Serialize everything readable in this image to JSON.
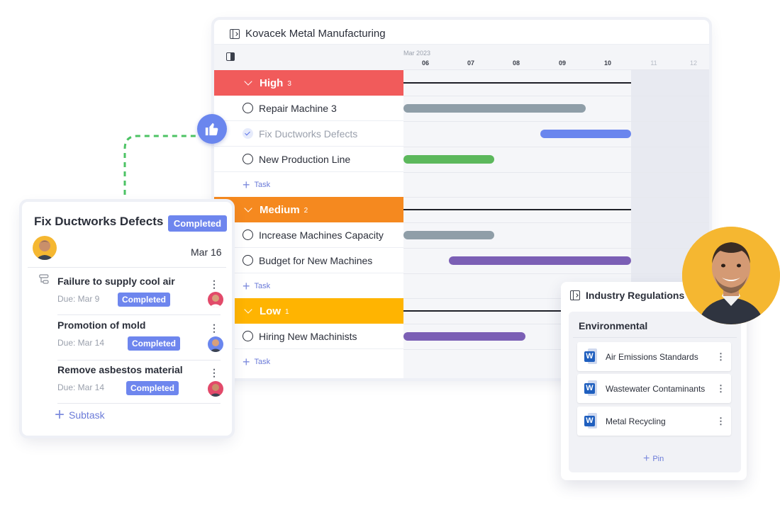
{
  "gantt": {
    "title": "Kovacek Metal Manufacturing",
    "month": "Mar 2023",
    "ticks": [
      "06",
      "07",
      "08",
      "09",
      "10",
      "11",
      "12"
    ],
    "groups": [
      {
        "label": "High",
        "count": "3",
        "color": "#f15b5b"
      },
      {
        "label": "Medium",
        "count": "2",
        "color": "#f5891f"
      },
      {
        "label": "Low",
        "count": "1",
        "color": "#ffb401"
      }
    ],
    "tasks": [
      {
        "label": "Repair Machine 3",
        "status": "open",
        "bar_color": "#8f9ea8"
      },
      {
        "label": "Fix Ductworks Defects",
        "status": "done",
        "bar_color": "#6a86ee"
      },
      {
        "label": "New Production Line",
        "status": "open",
        "bar_color": "#5cb85c"
      },
      {
        "label": "Increase Machines Capacity",
        "status": "open",
        "bar_color": "#8f9ea8"
      },
      {
        "label": "Budget for New Machines",
        "status": "open",
        "bar_color": "#7b5fb5"
      },
      {
        "label": "Hiring New Machinists",
        "status": "open",
        "bar_color": "#7b5fb5"
      }
    ],
    "add_task_label": "Task"
  },
  "task_card": {
    "title": "Fix Ductworks Defects",
    "status": "Completed",
    "date": "Mar 16",
    "subtasks": [
      {
        "title": "Failure to supply cool air",
        "due": "Due: Mar 9",
        "status": "Completed"
      },
      {
        "title": "Promotion of mold",
        "due": "Due: Mar 14",
        "status": "Completed"
      },
      {
        "title": "Remove asbestos material",
        "due": "Due: Mar 14",
        "status": "Completed"
      }
    ],
    "add_subtask_label": "Subtask"
  },
  "regulations": {
    "title": "Industry Regulations",
    "section": "Environmental",
    "documents": [
      {
        "name": "Air Emissions Standards"
      },
      {
        "name": "Wastewater Contaminants"
      },
      {
        "name": "Metal Recycling"
      }
    ],
    "add_pin_label": "Pin"
  },
  "colors": {
    "accent": "#6a86ee",
    "connector": "#4cc364"
  }
}
